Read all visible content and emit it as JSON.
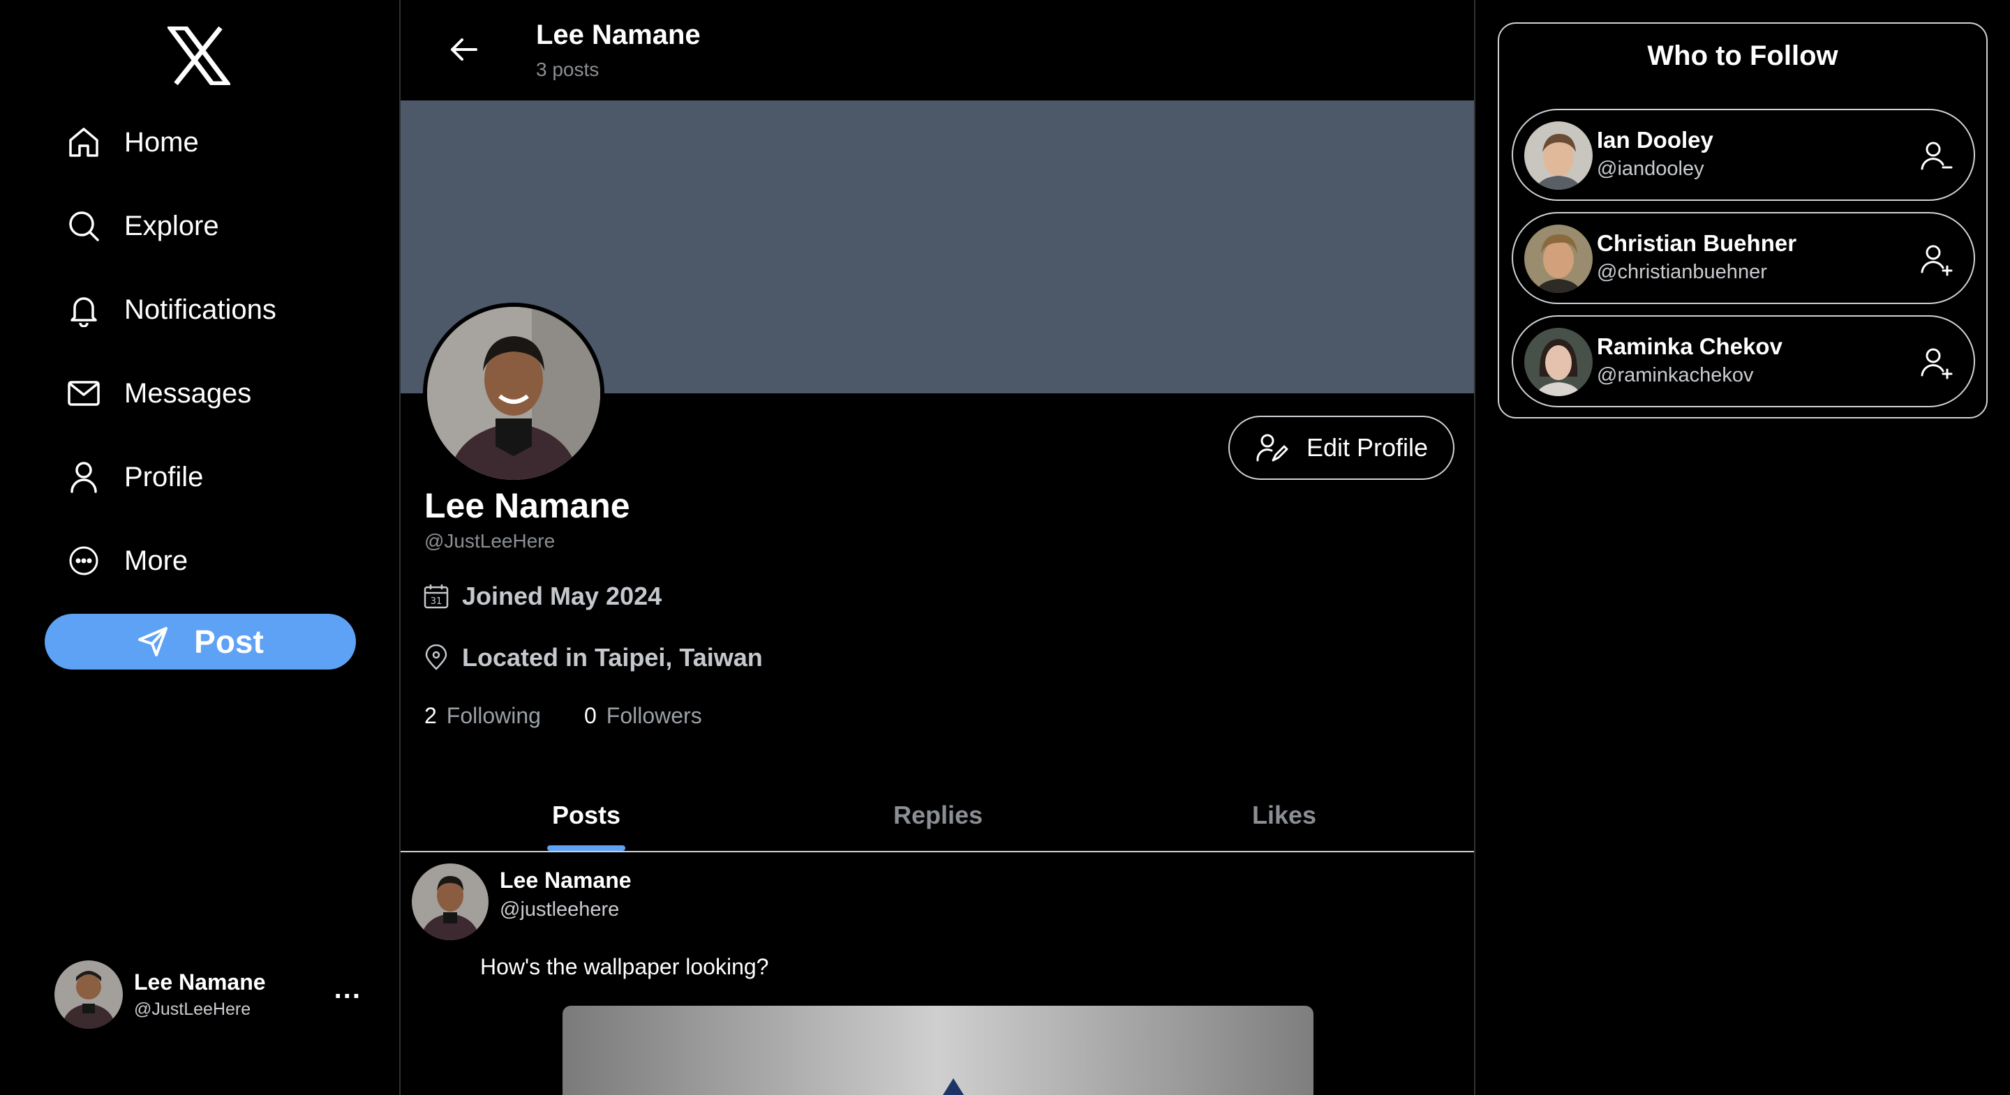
{
  "nav": {
    "items": [
      {
        "label": "Home",
        "icon": "home-icon"
      },
      {
        "label": "Explore",
        "icon": "search-icon"
      },
      {
        "label": "Notifications",
        "icon": "bell-icon"
      },
      {
        "label": "Messages",
        "icon": "mail-icon"
      },
      {
        "label": "Profile",
        "icon": "user-icon"
      },
      {
        "label": "More",
        "icon": "more-circle-icon"
      }
    ],
    "post_label": "Post"
  },
  "account": {
    "name": "Lee Namane",
    "handle": "@JustLeeHere",
    "more": "..."
  },
  "header": {
    "title": "Lee Namane",
    "subtitle": "3 posts"
  },
  "profile": {
    "name": "Lee Namane",
    "handle": "@JustLeeHere",
    "edit_label": "Edit Profile",
    "joined": "Joined May 2024",
    "location": "Located in Taipei, Taiwan",
    "following_count": "2",
    "following_label": "Following",
    "followers_count": "0",
    "followers_label": "Followers"
  },
  "tabs": [
    {
      "label": "Posts",
      "active": true
    },
    {
      "label": "Replies",
      "active": false
    },
    {
      "label": "Likes",
      "active": false
    }
  ],
  "post": {
    "name": "Lee Namane",
    "handle": "@justleehere",
    "text": "How's the wallpaper looking?"
  },
  "who_to_follow": {
    "title": "Who to Follow",
    "users": [
      {
        "name": "Ian Dooley",
        "handle": "@iandooley",
        "action": "unfollow-user-icon"
      },
      {
        "name": "Christian Buehner",
        "handle": "@christianbuehner",
        "action": "follow-user-icon"
      },
      {
        "name": "Raminka Chekov",
        "handle": "@raminkachekov",
        "action": "follow-user-icon"
      }
    ]
  },
  "colors": {
    "accent": "#5ea2f5",
    "banner": "#4d5868",
    "background": "#000000"
  }
}
